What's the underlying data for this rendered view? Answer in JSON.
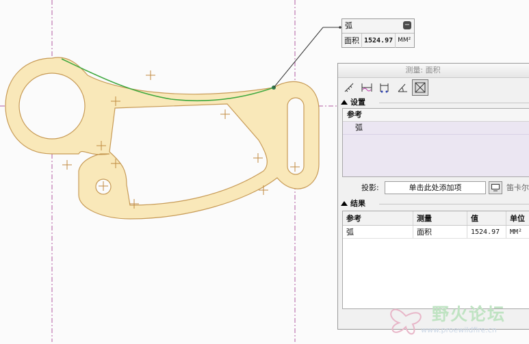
{
  "callout": {
    "title": "弧",
    "measure": "面积",
    "value": "1524.97",
    "unit": "MM²"
  },
  "panel": {
    "title": "测量: 面积",
    "tools": [
      "distance-tool-icon",
      "length-tool-icon",
      "diameter-tool-icon",
      "angle-tool-icon",
      "area-tool-icon"
    ],
    "settings_label": "设置",
    "reference_header": "参考",
    "reference_items": [
      "弧"
    ],
    "projection_label": "投影:",
    "projection_placeholder": "单击此处添加项",
    "projection_extra": "笛卡尔",
    "results_label": "结果",
    "results_columns": [
      "参考",
      "测量",
      "值",
      "单位"
    ],
    "results_rows": [
      [
        "弧",
        "面积",
        "1524.97",
        "MM²"
      ]
    ]
  },
  "watermark": {
    "brand": "野火论坛",
    "url": "www.proewildfire.cn"
  },
  "colors": {
    "part_fill": "#f9e8b9",
    "part_edge": "#c79a55",
    "selected_arc": "#3fa83f",
    "center_line": "#a8559a"
  }
}
